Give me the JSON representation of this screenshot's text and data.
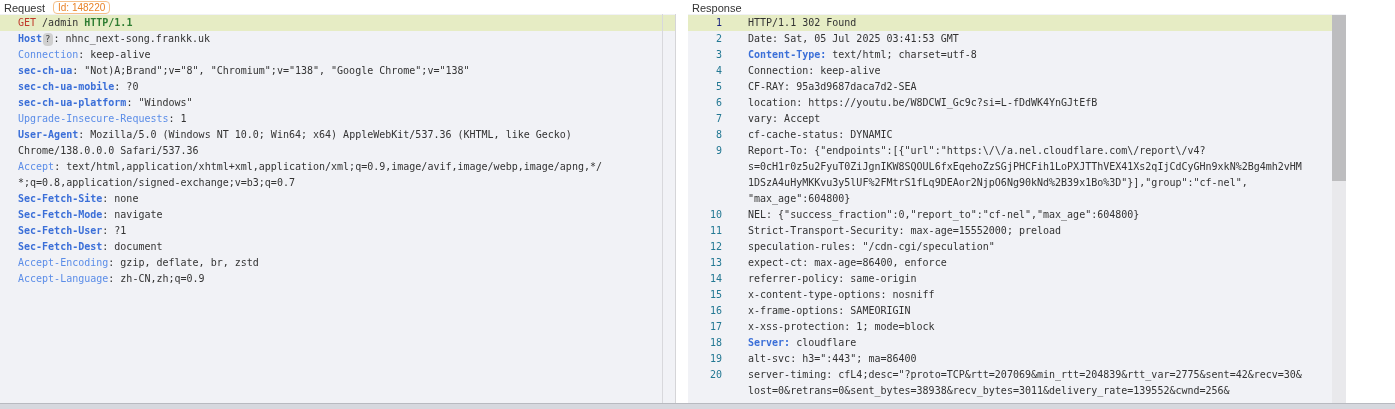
{
  "request": {
    "title": "Request",
    "id_badge": "Id: 148220",
    "lines": [
      {
        "kind": "request-line",
        "method": "GET",
        "path": "/admin",
        "version": "HTTP/1.1",
        "highlighted": true
      },
      {
        "kind": "header",
        "key": "Host",
        "colon": ":",
        "strong": true,
        "hint": "?",
        "value_lines": [
          "nhnc_next-song.frankk.uk"
        ],
        "highlighted": false
      },
      {
        "kind": "header",
        "key": "Connection",
        "colon": ":",
        "strong": false,
        "value_lines": [
          "keep-alive"
        ],
        "highlighted": false
      },
      {
        "kind": "header",
        "key": "sec-ch-ua",
        "colon": ":",
        "strong": true,
        "value_lines": [
          "\"Not)A;Brand\";v=\"8\", \"Chromium\";v=\"138\", \"Google Chrome\";v=\"138\""
        ],
        "highlighted": false
      },
      {
        "kind": "header",
        "key": "sec-ch-ua-mobile",
        "colon": ":",
        "strong": true,
        "value_lines": [
          "?0"
        ],
        "highlighted": false
      },
      {
        "kind": "header",
        "key": "sec-ch-ua-platform",
        "colon": ":",
        "strong": true,
        "value_lines": [
          "\"Windows\""
        ],
        "highlighted": false
      },
      {
        "kind": "header",
        "key": "Upgrade-Insecure-Requests",
        "colon": ":",
        "strong": false,
        "value_lines": [
          "1"
        ],
        "highlighted": false
      },
      {
        "kind": "header",
        "key": "User-Agent",
        "colon": ":",
        "strong": true,
        "value_lines": [
          "Mozilla/5.0 (Windows NT 10.0; Win64; x64) AppleWebKit/537.36 (KHTML, like Gecko)",
          "Chrome/138.0.0.0 Safari/537.36"
        ],
        "highlighted": false
      },
      {
        "kind": "header",
        "key": "Accept",
        "colon": ":",
        "strong": false,
        "value_lines": [
          "text/html,application/xhtml+xml,application/xml;q=0.9,image/avif,image/webp,image/apng,*/",
          "*;q=0.8,application/signed-exchange;v=b3;q=0.7"
        ],
        "highlighted": false
      },
      {
        "kind": "header",
        "key": "Sec-Fetch-Site",
        "colon": ":",
        "strong": true,
        "value_lines": [
          "none"
        ],
        "highlighted": false
      },
      {
        "kind": "header",
        "key": "Sec-Fetch-Mode",
        "colon": ":",
        "strong": true,
        "value_lines": [
          "navigate"
        ],
        "highlighted": false
      },
      {
        "kind": "header",
        "key": "Sec-Fetch-User",
        "colon": ":",
        "strong": true,
        "value_lines": [
          "?1"
        ],
        "highlighted": false
      },
      {
        "kind": "header",
        "key": "Sec-Fetch-Dest",
        "colon": ":",
        "strong": true,
        "value_lines": [
          "document"
        ],
        "highlighted": false
      },
      {
        "kind": "header",
        "key": "Accept-Encoding",
        "colon": ":",
        "strong": false,
        "value_lines": [
          "gzip, deflate, br, zstd"
        ],
        "highlighted": false
      },
      {
        "kind": "header",
        "key": "Accept-Language",
        "colon": ":",
        "strong": false,
        "value_lines": [
          "zh-CN,zh;q=0.9"
        ],
        "highlighted": false
      }
    ]
  },
  "response": {
    "title": "Response",
    "lines": [
      {
        "number": "1",
        "text_lines": [
          "HTTP/1.1 302 Found"
        ],
        "highlighted": true
      },
      {
        "number": "2",
        "text_lines": [
          "Date: Sat, 05 Jul 2025 03:41:53 GMT"
        ],
        "highlighted": false
      },
      {
        "number": "3",
        "key": "Content-Type:",
        "text_lines": [
          "text/html; charset=utf-8"
        ],
        "highlighted": false
      },
      {
        "number": "4",
        "text_lines": [
          "Connection: keep-alive"
        ],
        "highlighted": false
      },
      {
        "number": "5",
        "text_lines": [
          "CF-RAY: 95a3d9687daca7d2-SEA"
        ],
        "highlighted": false
      },
      {
        "number": "6",
        "text_lines": [
          "location: https://youtu.be/W8DCWI_Gc9c?si=L-fDdWK4YnGJtEfB"
        ],
        "highlighted": false
      },
      {
        "number": "7",
        "text_lines": [
          "vary: Accept"
        ],
        "highlighted": false
      },
      {
        "number": "8",
        "text_lines": [
          "cf-cache-status: DYNAMIC"
        ],
        "highlighted": false
      },
      {
        "number": "9",
        "text_lines": [
          "Report-To: {\"endpoints\":[{\"url\":\"https:\\/\\/a.nel.cloudflare.com\\/report\\/v4?",
          "s=0cH1r0z5u2FyuT0ZiJgnIKW8SQOUL6fxEqehoZzSGjPHCFih1LoPXJTThVEX41Xs2qIjCdCyGHn9xkN%2Bg4mh2vHM",
          "1DSzA4uHyMKKvu3y5lUF%2FMtrS1fLq9DEAor2NjpO6Ng90kNd%2B39x1Bo%3D\"}],\"group\":\"cf-nel\",",
          "\"max_age\":604800}"
        ],
        "highlighted": false
      },
      {
        "number": "10",
        "text_lines": [
          "NEL: {\"success_fraction\":0,\"report_to\":\"cf-nel\",\"max_age\":604800}"
        ],
        "highlighted": false
      },
      {
        "number": "11",
        "text_lines": [
          "Strict-Transport-Security: max-age=15552000; preload"
        ],
        "highlighted": false
      },
      {
        "number": "12",
        "text_lines": [
          "speculation-rules: \"/cdn-cgi/speculation\""
        ],
        "highlighted": false
      },
      {
        "number": "13",
        "text_lines": [
          "expect-ct: max-age=86400, enforce"
        ],
        "highlighted": false
      },
      {
        "number": "14",
        "text_lines": [
          "referrer-policy: same-origin"
        ],
        "highlighted": false
      },
      {
        "number": "15",
        "text_lines": [
          "x-content-type-options: nosniff"
        ],
        "highlighted": false
      },
      {
        "number": "16",
        "text_lines": [
          "x-frame-options: SAMEORIGIN"
        ],
        "highlighted": false
      },
      {
        "number": "17",
        "text_lines": [
          "x-xss-protection: 1; mode=block"
        ],
        "highlighted": false
      },
      {
        "number": "18",
        "key": "Server:",
        "text_lines": [
          "cloudflare"
        ],
        "highlighted": false
      },
      {
        "number": "19",
        "text_lines": [
          "alt-svc: h3=\":443\"; ma=86400"
        ],
        "highlighted": false
      },
      {
        "number": "20",
        "text_lines": [
          "server-timing: cfL4;desc=\"?proto=TCP&rtt=207069&min_rtt=204839&rtt_var=2775&sent=42&recv=30&",
          "lost=0&retrans=0&sent_bytes=38938&recv_bytes=3011&delivery_rate=139552&cwnd=256&"
        ],
        "highlighted": false
      }
    ]
  }
}
